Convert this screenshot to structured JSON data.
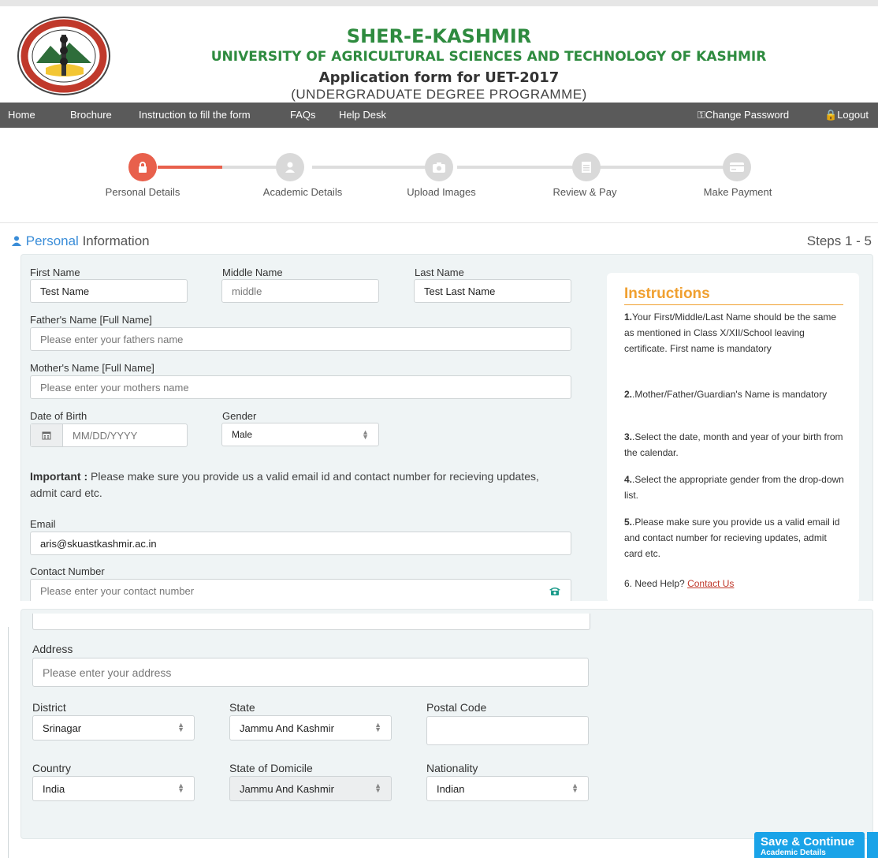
{
  "header": {
    "title1": "SHER-E-KASHMIR",
    "title2": "UNIVERSITY OF AGRICULTURAL SCIENCES AND TECHNOLOGY OF KASHMIR",
    "title3": "Application form for UET-2017",
    "title4": "(UNDERGRADUATE DEGREE PROGRAMME)"
  },
  "nav": {
    "items": [
      "Home",
      "Brochure",
      "Instruction to fill the form",
      "FAQs",
      "Help Desk"
    ],
    "change_password": "Change Password",
    "logout": "Logout"
  },
  "stepper": {
    "steps": [
      "Personal Details",
      "Academic Details",
      "Upload Images",
      "Review & Pay",
      "Make Payment"
    ],
    "active_index": 0
  },
  "section": {
    "title_blue": "Personal",
    "title_rest": " Information",
    "steps": "Steps 1 - 5"
  },
  "form": {
    "first_name_label": "First Name",
    "first_name_value": "Test Name",
    "middle_name_label": "Middle Name",
    "middle_name_value": "middle",
    "last_name_label": "Last Name",
    "last_name_value": "Test Last Name",
    "father_label": "Father's Name [Full Name]",
    "father_placeholder": "Please enter your fathers name",
    "mother_label": "Mother's Name [Full Name]",
    "mother_placeholder": "Please enter your mothers name",
    "dob_label": "Date of Birth",
    "dob_placeholder": "MM/DD/YYYY",
    "gender_label": "Gender",
    "gender_value": "Male",
    "important_bold": "Important :",
    "important_text": " Please make sure you provide us a valid email id and contact number for recieving updates, admit card etc.",
    "email_label": "Email",
    "email_value": "aris@skuastkashmir.ac.in",
    "contact_label": "Contact Number",
    "contact_placeholder": "Please enter your contact number",
    "address_label": "Address",
    "address_placeholder": "Please enter your address",
    "district_label": "District",
    "district_value": "Srinagar",
    "state_label": "State",
    "state_value": "Jammu And Kashmir",
    "postal_label": "Postal Code",
    "postal_value": "",
    "country_label": "Country",
    "country_value": "India",
    "domicile_label": "State of Domicile",
    "domicile_value": "Jammu And Kashmir",
    "nationality_label": "Nationality",
    "nationality_value": "Indian"
  },
  "instructions": {
    "title": "Instructions",
    "i1_num": "1.",
    "i1": "Your First/Middle/Last Name should be the same as mentioned in Class X/XII/School leaving certificate. First name is mandatory",
    "i2_num": "2.",
    "i2": ".Mother/Father/Guardian's Name is mandatory",
    "i3_num": "3.",
    "i3": ".Select the date, month and year of your birth from the calendar.",
    "i4_num": "4.",
    "i4": ".Select the appropriate gender from the drop-down list.",
    "i5_num": "5.",
    "i5": ".Please make sure you provide us a valid email id and contact number for recieving updates, admit card etc.",
    "i6": "6. Need Help? ",
    "contact_link": "Contact Us"
  },
  "buttons": {
    "save_main": "Save & Continue",
    "save_sub": "Academic Details"
  },
  "colors": {
    "accent": "#e8604c",
    "brand_green": "#2e8b3f",
    "link_blue": "#3a8dd8",
    "button_blue": "#1aa3e8",
    "instruction_orange": "#f0a030",
    "navbar": "#5a5a5a"
  },
  "icons": {
    "step1": "lock-icon",
    "step2": "user-icon",
    "step3": "camera-icon",
    "step4": "document-icon",
    "step5": "credit-card-icon"
  }
}
